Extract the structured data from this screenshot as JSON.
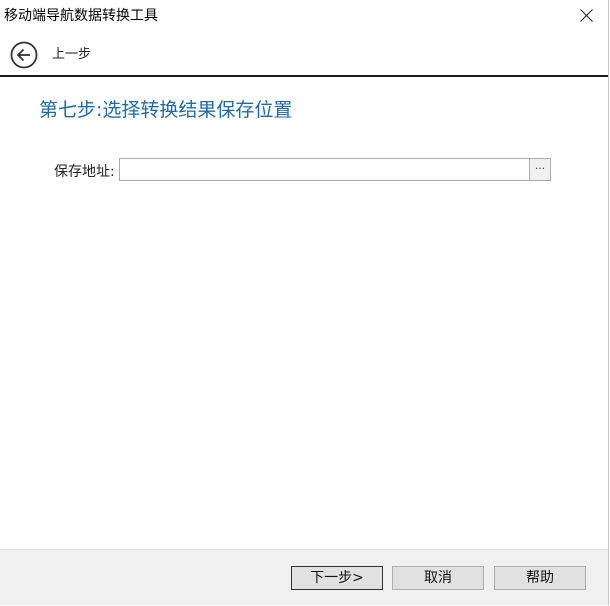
{
  "window": {
    "title": "移动端导航数据转换工具"
  },
  "nav": {
    "back_label": "上一步"
  },
  "step": {
    "title": "第七步:选择转换结果保存位置"
  },
  "form": {
    "save_path_label": "保存地址:",
    "save_path_value": "",
    "browse_label": "···"
  },
  "footer": {
    "next_label": "下一步>",
    "cancel_label": "取消",
    "help_label": "帮助"
  },
  "colors": {
    "accent": "#1e6aa8",
    "footer_bg": "#f0f0f0"
  },
  "icons": {
    "close": "close-icon",
    "back": "back-arrow-circle-icon"
  }
}
